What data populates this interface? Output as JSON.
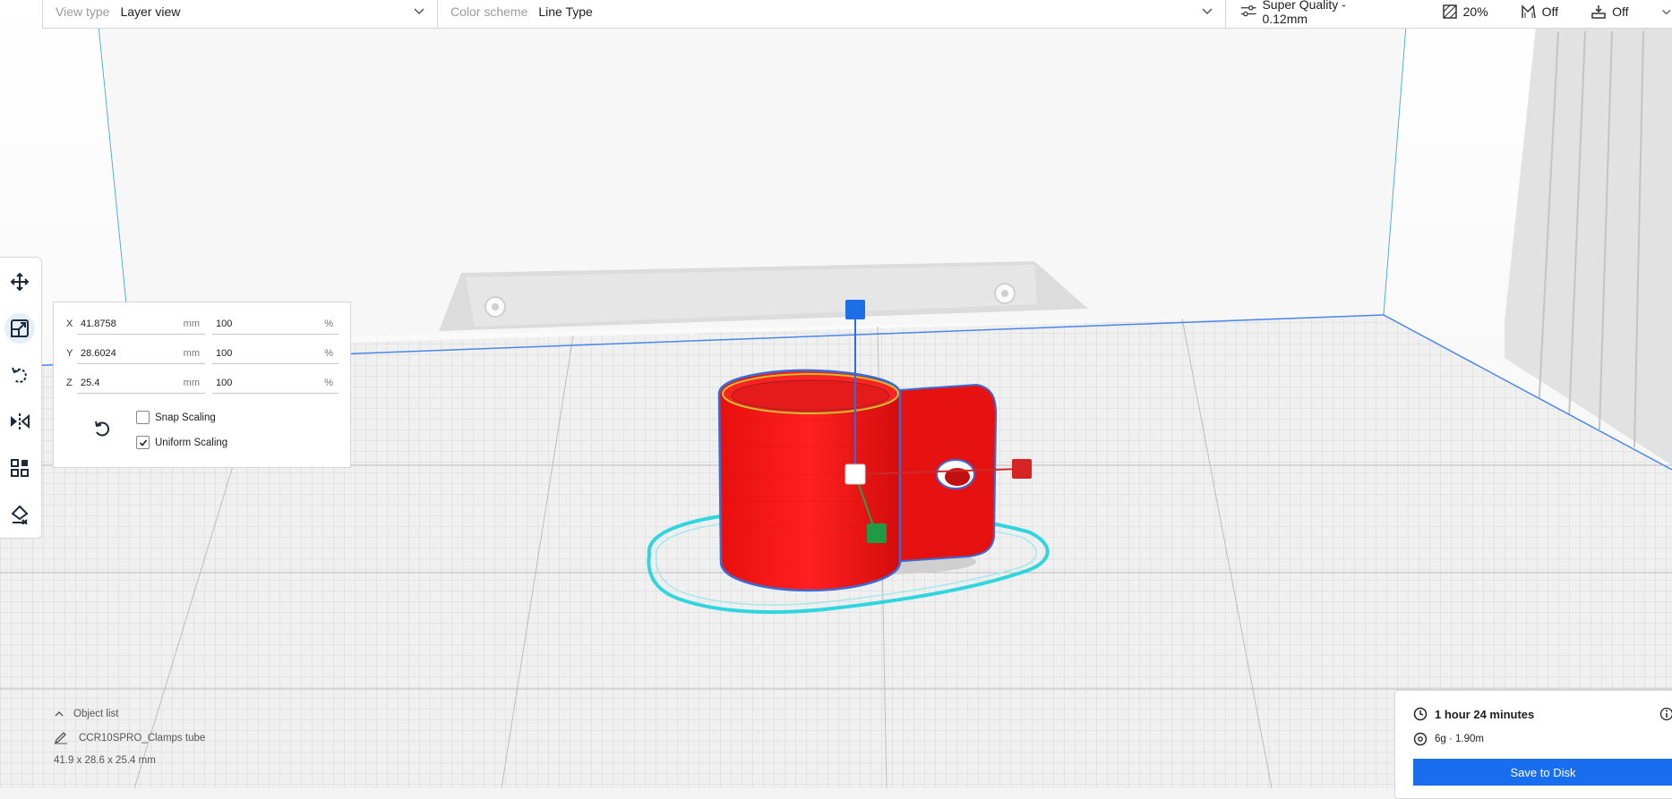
{
  "topbar": {
    "view_type_label": "View type",
    "view_type_value": "Layer view",
    "color_scheme_label": "Color scheme",
    "color_scheme_value": "Line Type",
    "profile": "Super Quality - 0.12mm",
    "infill": "20%",
    "support": "Off",
    "adhesion": "Off"
  },
  "toolbar": {
    "tools": [
      "move-tool",
      "scale-tool",
      "rotate-tool",
      "mirror-tool",
      "per-model-settings-tool",
      "support-blocker-tool"
    ],
    "active": "scale-tool"
  },
  "scale_panel": {
    "x": {
      "axis": "X",
      "mm": "41.8758",
      "percent": "100",
      "unit_mm": "mm",
      "unit_pct": "%"
    },
    "y": {
      "axis": "Y",
      "mm": "28.6024",
      "percent": "100",
      "unit_mm": "mm",
      "unit_pct": "%"
    },
    "z": {
      "axis": "Z",
      "mm": "25.4",
      "percent": "100",
      "unit_mm": "mm",
      "unit_pct": "%"
    },
    "snap_scaling": {
      "label": "Snap Scaling",
      "checked": false
    },
    "uniform_scaling": {
      "label": "Uniform Scaling",
      "checked": true
    }
  },
  "object_list": {
    "title": "Object list",
    "object_name": "CCR10SPRO_Clamps tube",
    "dimensions": "41.9 x 28.6 x 25.4 mm"
  },
  "print_summary": {
    "time": "1 hour 24 minutes",
    "material": "6g · 1.90m",
    "save_label": "Save to Disk"
  },
  "colors": {
    "accent": "#196ef0",
    "model": "#ff1a1a",
    "skirt": "#2fd6e0",
    "plate": "#f0f0f0"
  }
}
